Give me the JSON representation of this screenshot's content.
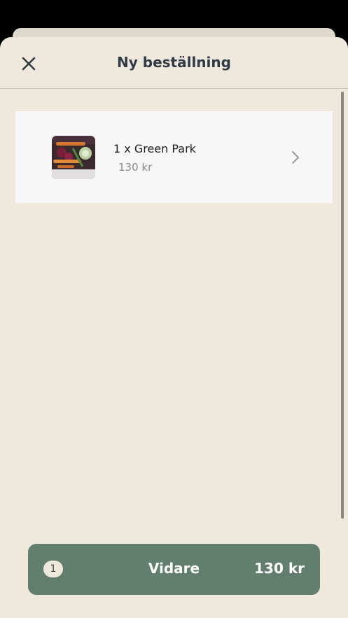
{
  "header": {
    "title": "Ny beställning",
    "close_icon": "close-icon"
  },
  "order_items": [
    {
      "name": "1 x Green Park",
      "price": "130 kr",
      "thumbnail": "food-image",
      "chevron_icon": "chevron-right-icon"
    }
  ],
  "footer": {
    "item_count": "1",
    "continue_label": "Vidare",
    "total": "130 kr"
  },
  "colors": {
    "background": "#efe8dd",
    "card": "#f7f7f7",
    "primary_button": "#617e6f",
    "title_text": "#2f3a45"
  }
}
